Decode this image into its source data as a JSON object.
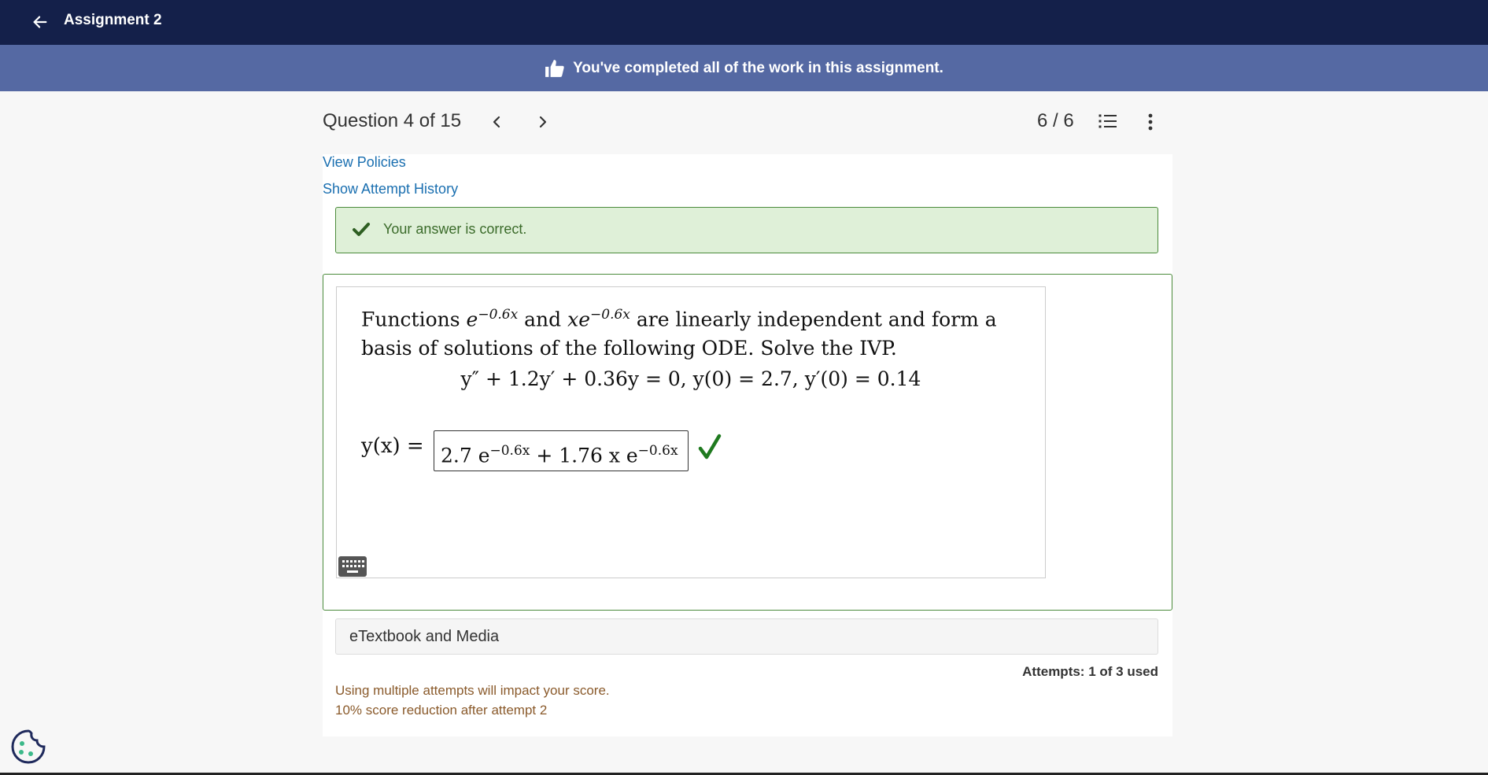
{
  "header": {
    "title": "Assignment 2",
    "back_icon": "arrow-left-icon"
  },
  "banner": {
    "text": "You've completed all of the work in this assignment.",
    "icon": "thumbs-up-icon"
  },
  "question_nav": {
    "label": "Question 4 of 15",
    "score": "6 / 6",
    "prev_icon": "chevron-left-icon",
    "next_icon": "chevron-right-icon",
    "list_icon": "question-list-icon",
    "more_icon": "more-vertical-icon"
  },
  "links": {
    "view_policies": "View Policies",
    "show_attempt_history": "Show Attempt History"
  },
  "feedback": {
    "text": "Your answer is correct.",
    "icon": "checkmark-icon"
  },
  "question": {
    "intro_1": "Functions ",
    "func1_base": "e",
    "func1_exp": "−0.6x",
    "and_text": " and ",
    "func2_base": "xe",
    "func2_exp": "−0.6x",
    "intro_2": " are linearly independent and form a basis of solutions of the following ODE. Solve the IVP.",
    "equation": "y″ + 1.2y′ + 0.36y = 0, y(0) = 2.7, y′(0) = 0.14",
    "answer_label": "y(x) =",
    "answer_part1": "2.7 e",
    "answer_exp1": "−0.6x",
    "answer_part2": " + 1.76 x e",
    "answer_exp2": "−0.6x",
    "answer_status_icon": "correct-check-icon",
    "keyboard_icon": "keyboard-icon"
  },
  "media": {
    "label": "eTextbook and Media"
  },
  "attempts": {
    "text": "Attempts: 1 of 3 used"
  },
  "policy": {
    "line1": "Using multiple attempts will impact your score.",
    "line2": "10% score reduction after attempt 2"
  },
  "cookie_icon": "cookie-icon",
  "colors": {
    "topbar": "#14204a",
    "banner": "#5569a3",
    "correct_green": "#2e7d32",
    "link_blue": "#1a6fb0",
    "policy_brown": "#8a5a2b"
  }
}
